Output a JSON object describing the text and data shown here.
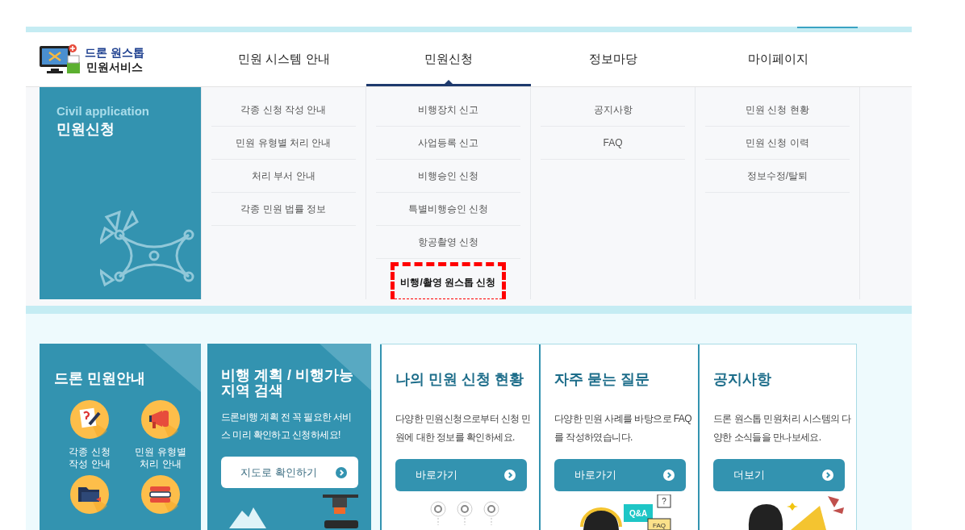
{
  "logo": {
    "line1": "드론 원스톱",
    "line2": "민원서비스"
  },
  "nav": [
    {
      "label": "민원 시스템 안내",
      "selected": false
    },
    {
      "label": "민원신청",
      "selected": true
    },
    {
      "label": "정보마당",
      "selected": false
    },
    {
      "label": "마이페이지",
      "selected": false
    }
  ],
  "dropdown": {
    "panel": {
      "subtitle": "Civil application",
      "title": "민원신청"
    },
    "columns": [
      {
        "items": [
          {
            "label": "각종 신청 작성 안내",
            "highlighted": false
          },
          {
            "label": "민원 유형별 처리 안내",
            "highlighted": false
          },
          {
            "label": "처리 부서 안내",
            "highlighted": false
          },
          {
            "label": "각종 민원 법률 정보",
            "highlighted": false
          }
        ]
      },
      {
        "items": [
          {
            "label": "비행장치 신고",
            "highlighted": false
          },
          {
            "label": "사업등록 신고",
            "highlighted": false
          },
          {
            "label": "비행승인 신청",
            "highlighted": false
          },
          {
            "label": "특별비행승인 신청",
            "highlighted": false
          },
          {
            "label": "항공촬영 신청",
            "highlighted": false
          },
          {
            "label": "비행/촬영 원스톱 신청",
            "highlighted": true
          }
        ]
      },
      {
        "items": [
          {
            "label": "공지사항",
            "highlighted": false
          },
          {
            "label": "FAQ",
            "highlighted": false
          }
        ]
      },
      {
        "items": [
          {
            "label": "민원 신청 현황",
            "highlighted": false
          },
          {
            "label": "민원 신청 이력",
            "highlighted": false
          },
          {
            "label": "정보수정/탈퇴",
            "highlighted": false
          }
        ]
      }
    ]
  },
  "cards": [
    {
      "kind": "guide",
      "title": "드론 민원안내",
      "items": [
        {
          "kind": "form",
          "label": "각종 신청\n작성 안내"
        },
        {
          "kind": "megaphone",
          "label": "민원 유형별\n처리 안내"
        },
        {
          "kind": "folder"
        },
        {
          "kind": "books"
        }
      ]
    },
    {
      "kind": "map",
      "title": "비행 계획 / 비행가능 지역 검색",
      "description": "드론비행 계획 전 꼭 필요한 서비스 미리 확인하고 신청하세요!",
      "button": "지도로 확인하기"
    },
    {
      "kind": "link",
      "illustration": {
        "kind": "steps"
      },
      "title": "나의 민원 신청 현황",
      "description": "다양한 민원신청으로부터 신청 민원에 대한 정보를 확인하세요.",
      "button": "바로가기"
    },
    {
      "kind": "link",
      "illustration": {
        "kind": "qna",
        "labels": [
          "Q&A",
          "?",
          "FAQ"
        ]
      },
      "title": "자주 묻는 질문",
      "description": "다양한 민원 사례를 바탕으로 FAQ를 작성하였습니다.",
      "button": "바로가기"
    },
    {
      "kind": "link",
      "illustration": {
        "kind": "announce"
      },
      "title": "공지사항",
      "description": "드론 원스톱 민원처리 시스템의 다양한 소식들을 만나보세요.",
      "button": "더보기"
    }
  ]
}
